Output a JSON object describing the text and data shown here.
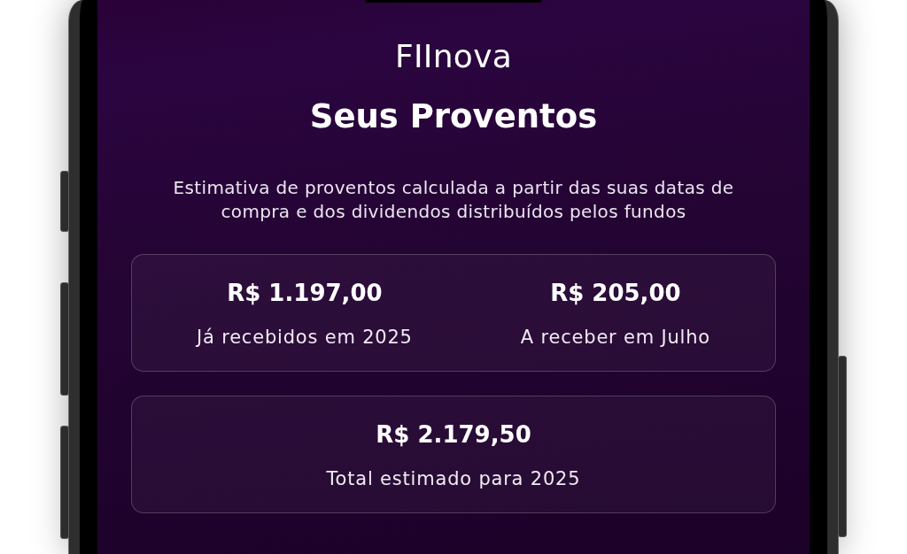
{
  "app": {
    "name": "FIInova"
  },
  "page": {
    "title": "Seus Proventos",
    "description": "Estimativa de proventos calculada a partir das suas datas de compra e dos dividendos distribuídos pelos fundos"
  },
  "summary_cards": [
    {
      "stats": [
        {
          "value": "R$ 1.197,00",
          "label": "Já recebidos em 2025"
        },
        {
          "value": "R$ 205,00",
          "label": "A receber em Julho"
        }
      ]
    },
    {
      "stats": [
        {
          "value": "R$ 2.179,50",
          "label": "Total estimado para 2025"
        }
      ]
    }
  ]
}
